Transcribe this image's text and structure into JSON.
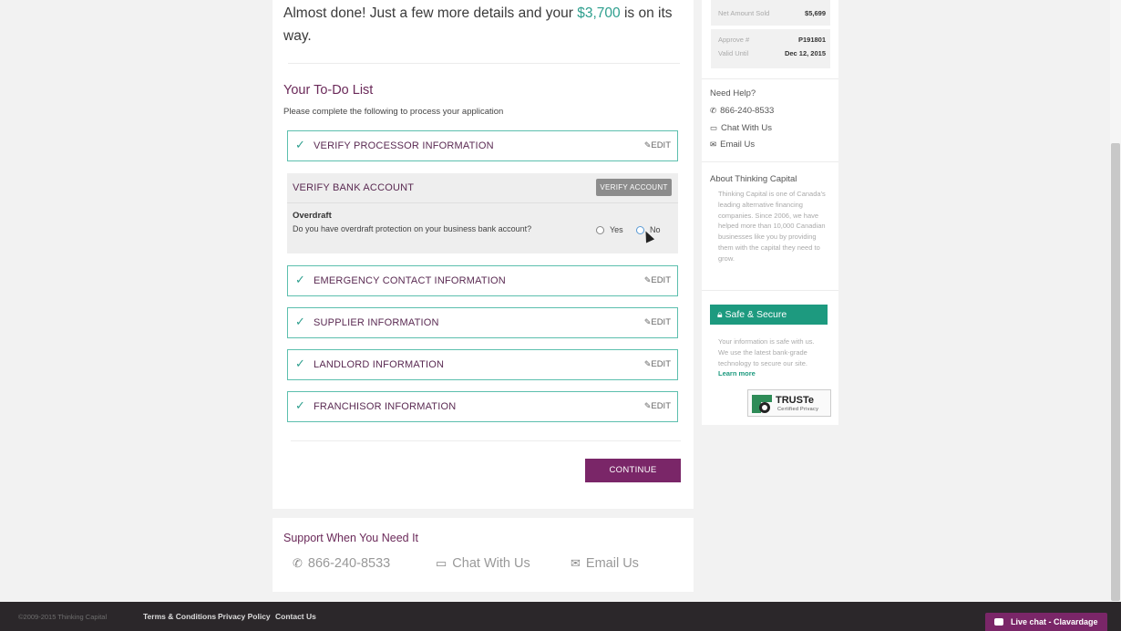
{
  "main": {
    "headline_pre": "Almost done! Just a few more details and your ",
    "headline_amount": "$3,700",
    "headline_post": " is on its way.",
    "todo_title": "Your To-Do List",
    "todo_subtitle": "Please complete the following to process your application",
    "tasks": [
      {
        "label": "VERIFY PROCESSOR INFORMATION",
        "edit": "EDIT"
      },
      {
        "label": "EMERGENCY CONTACT INFORMATION",
        "edit": "EDIT"
      },
      {
        "label": "SUPPLIER INFORMATION",
        "edit": "EDIT"
      },
      {
        "label": "LANDLORD INFORMATION",
        "edit": "EDIT"
      },
      {
        "label": "FRANCHISOR INFORMATION",
        "edit": "EDIT"
      }
    ],
    "bank": {
      "label": "VERIFY BANK ACCOUNT",
      "button": "VERIFY ACCOUNT",
      "overdraft_title": "Overdraft",
      "overdraft_question": "Do you have overdraft protection on your business bank account?",
      "yes": "Yes",
      "no": "No"
    },
    "continue": "CONTINUE"
  },
  "support": {
    "title": "Support When You Need It",
    "phone": "866-240-8533",
    "chat": "Chat With Us",
    "email": "Email Us"
  },
  "sidebar": {
    "net_amount_label": "Net Amount Sold",
    "net_amount_value": "$5,699",
    "approve_label": "Approve #",
    "approve_value": "P191801",
    "valid_label": "Valid Until",
    "valid_value": "Dec 12, 2015",
    "need_help": "Need Help?",
    "phone": "866-240-8533",
    "chat": "Chat With Us",
    "email": "Email Us",
    "about_title": "About Thinking Capital",
    "about_text": "Thinking Capital is one of Canada's leading alternative financing companies. Since 2006, we have helped more than 10,000 Canadian businesses like you by providing them with the capital they need to grow.",
    "secure_label": "Safe & Secure",
    "secure_text": "Your information is safe with us. We use the latest bank-grade technology to secure our site.",
    "learn_more": "Learn more",
    "truste_title": "TRUSTe",
    "truste_sub": "Certified Privacy"
  },
  "footer": {
    "copyright": "©2009-2015 Thinking Capital",
    "terms": "Terms & Conditions",
    "privacy": "Privacy Policy",
    "contact": "Contact Us",
    "live_chat": "Live chat - Clavardage"
  },
  "colors": {
    "accent_purple": "#7a2668",
    "accent_teal": "#2e9f8e",
    "secure_green": "#1d9a7f"
  }
}
